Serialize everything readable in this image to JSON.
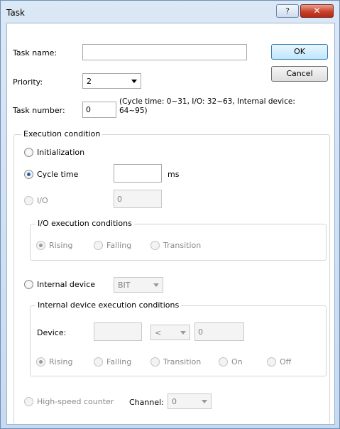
{
  "window": {
    "title": "Task",
    "help_glyph": "?",
    "close_glyph": "✕"
  },
  "form": {
    "task_name_label": "Task name:",
    "task_name_value": "",
    "priority_label": "Priority:",
    "priority_value": "2",
    "task_number_label": "Task number:",
    "task_number_value": "0",
    "task_number_hint": "(Cycle time: 0~31, I/O: 32~63, Internal device: 64~95)",
    "ok_label": "OK",
    "cancel_label": "Cancel"
  },
  "execution": {
    "group_title": "Execution condition",
    "initialization_label": "Initialization",
    "cycle_time_label": "Cycle time",
    "cycle_time_value": "",
    "cycle_time_unit": "ms",
    "io_label": "I/O",
    "io_value": "0",
    "io_group_title": "I/O execution conditions",
    "io_rising": "Rising",
    "io_falling": "Falling",
    "io_transition": "Transition",
    "internal_device_label": "Internal device",
    "internal_device_type": "BIT",
    "internal_group_title": "Internal device execution conditions",
    "device_label": "Device:",
    "device_value": "",
    "device_operator": "<",
    "device_compare_value": "0",
    "int_rising": "Rising",
    "int_falling": "Falling",
    "int_transition": "Transition",
    "int_on": "On",
    "int_off": "Off",
    "hsc_label": "High-speed counter",
    "channel_label": "Channel:",
    "channel_value": "0"
  }
}
